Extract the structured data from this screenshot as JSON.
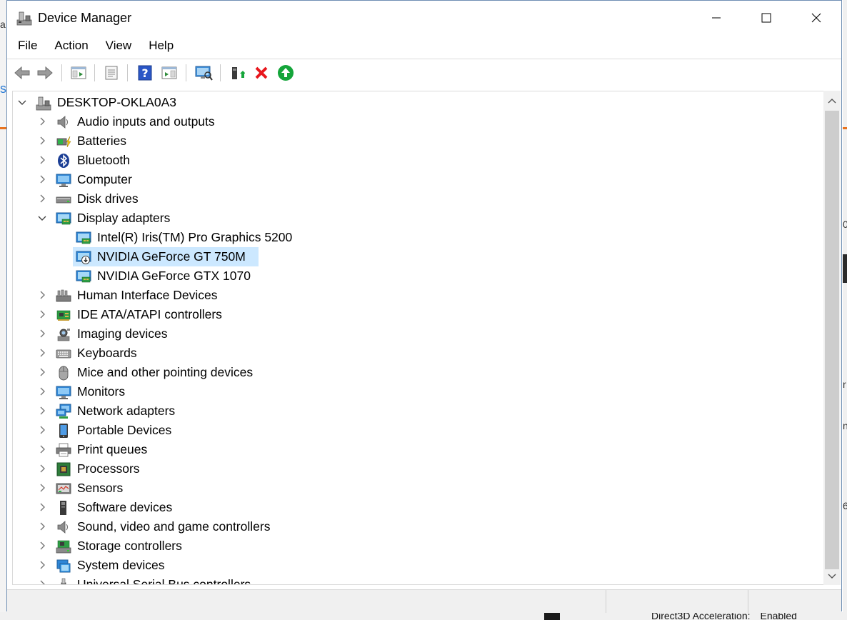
{
  "window": {
    "title": "Device Manager"
  },
  "menu": [
    "File",
    "Action",
    "View",
    "Help"
  ],
  "tree": {
    "root": "DESKTOP-OKLA0A3",
    "rows": [
      {
        "label": "Audio inputs and outputs",
        "icon": "speaker-icon",
        "expanded": false,
        "level": 1
      },
      {
        "label": "Batteries",
        "icon": "battery-icon",
        "expanded": false,
        "level": 1
      },
      {
        "label": "Bluetooth",
        "icon": "bluetooth-icon",
        "expanded": false,
        "level": 1
      },
      {
        "label": "Computer",
        "icon": "computer-icon",
        "expanded": false,
        "level": 1
      },
      {
        "label": "Disk drives",
        "icon": "disk-drive-icon",
        "expanded": false,
        "level": 1
      },
      {
        "label": "Display adapters",
        "icon": "display-adapter-icon",
        "expanded": true,
        "level": 1
      },
      {
        "label": "Intel(R) Iris(TM) Pro Graphics 5200",
        "icon": "display-adapter-icon",
        "level": 2
      },
      {
        "label": "NVIDIA GeForce GT 750M",
        "icon": "display-adapter-disabled-icon",
        "level": 2,
        "selected": true
      },
      {
        "label": "NVIDIA GeForce GTX 1070",
        "icon": "display-adapter-icon",
        "level": 2
      },
      {
        "label": "Human Interface Devices",
        "icon": "hid-icon",
        "expanded": false,
        "level": 1
      },
      {
        "label": "IDE ATA/ATAPI controllers",
        "icon": "ide-controller-icon",
        "expanded": false,
        "level": 1
      },
      {
        "label": "Imaging devices",
        "icon": "camera-icon",
        "expanded": false,
        "level": 1
      },
      {
        "label": "Keyboards",
        "icon": "keyboard-icon",
        "expanded": false,
        "level": 1
      },
      {
        "label": "Mice and other pointing devices",
        "icon": "mouse-icon",
        "expanded": false,
        "level": 1
      },
      {
        "label": "Monitors",
        "icon": "monitor-icon",
        "expanded": false,
        "level": 1
      },
      {
        "label": "Network adapters",
        "icon": "network-icon",
        "expanded": false,
        "level": 1
      },
      {
        "label": "Portable Devices",
        "icon": "portable-device-icon",
        "expanded": false,
        "level": 1
      },
      {
        "label": "Print queues",
        "icon": "printer-icon",
        "expanded": false,
        "level": 1
      },
      {
        "label": "Processors",
        "icon": "processor-icon",
        "expanded": false,
        "level": 1
      },
      {
        "label": "Sensors",
        "icon": "sensor-icon",
        "expanded": false,
        "level": 1
      },
      {
        "label": "Software devices",
        "icon": "software-device-icon",
        "expanded": false,
        "level": 1
      },
      {
        "label": "Sound, video and game controllers",
        "icon": "speaker-icon",
        "expanded": false,
        "level": 1
      },
      {
        "label": "Storage controllers",
        "icon": "storage-controller-icon",
        "expanded": false,
        "level": 1
      },
      {
        "label": "System devices",
        "icon": "system-device-icon",
        "expanded": false,
        "level": 1
      },
      {
        "label": "Universal Serial Bus controllers",
        "icon": "usb-icon",
        "expanded": false,
        "level": 1
      }
    ]
  },
  "background": {
    "right_glyphs": [
      "0",
      "r",
      "ni",
      "6"
    ],
    "left_glyphs": [
      "a",
      "s"
    ],
    "bottom_text": {
      "label": "Direct3D Acceleration:",
      "value": "Enabled"
    }
  },
  "colors": {
    "selection": "#cce8ff",
    "accent_blue": "#2a7bd5",
    "delete_red": "#e8161c",
    "enable_green": "#14a53a"
  }
}
